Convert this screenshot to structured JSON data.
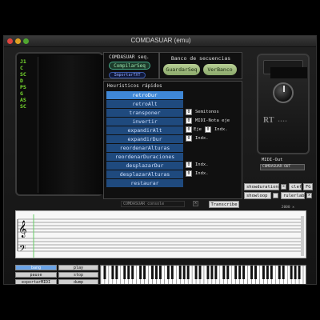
{
  "window": {
    "title": "COMDASUAR (emu)"
  },
  "left_vars": [
    "J1",
    "C",
    "SC",
    "D",
    "PS",
    "G",
    "AS",
    "SC"
  ],
  "seq": {
    "label": "COMDASUAR seq.",
    "compilar": "CompilarSeq",
    "importar": "ImportarTXT"
  },
  "banco": {
    "label": "Banco de secuencias",
    "guardar": "GuardarSeq",
    "ver": "VerBanco"
  },
  "heur": {
    "label": "Heurísticos rápidos",
    "buttons": [
      "retroDur",
      "retroAlt",
      "transponer",
      "invertir",
      "expandirAlt",
      "expandirDur",
      "reordenarAlturas",
      "reordenarDuraciones",
      "desplazarDur",
      "desplazarAlturas",
      "restaurar"
    ],
    "selected": 0,
    "semitonos": "Semitonos",
    "midi_nota_eje": "MIDI-Nota eje",
    "eje": "Eje",
    "indx": "Indx.",
    "zero": "0"
  },
  "device": {
    "rt": "RT",
    "sub": "••••"
  },
  "midi": {
    "label": "MIDI-Out",
    "value": "COMDASUAR-OUT"
  },
  "opts": {
    "showdurations": "showdurations",
    "clefs": "clefs",
    "fg": "FG",
    "showloop": "showloop",
    "rulerlabels": "rulerlabels",
    "x": "✕"
  },
  "console": {
    "label": "COMDASUAR console",
    "transcribe": "Transcribe"
  },
  "score": {
    "count": "2000 ✕"
  },
  "bottom": {
    "bang": "bang",
    "play": "play",
    "pause": "pause",
    "stop": "stop",
    "exportarmidi": "exportarMIDI",
    "dump": "dump"
  }
}
